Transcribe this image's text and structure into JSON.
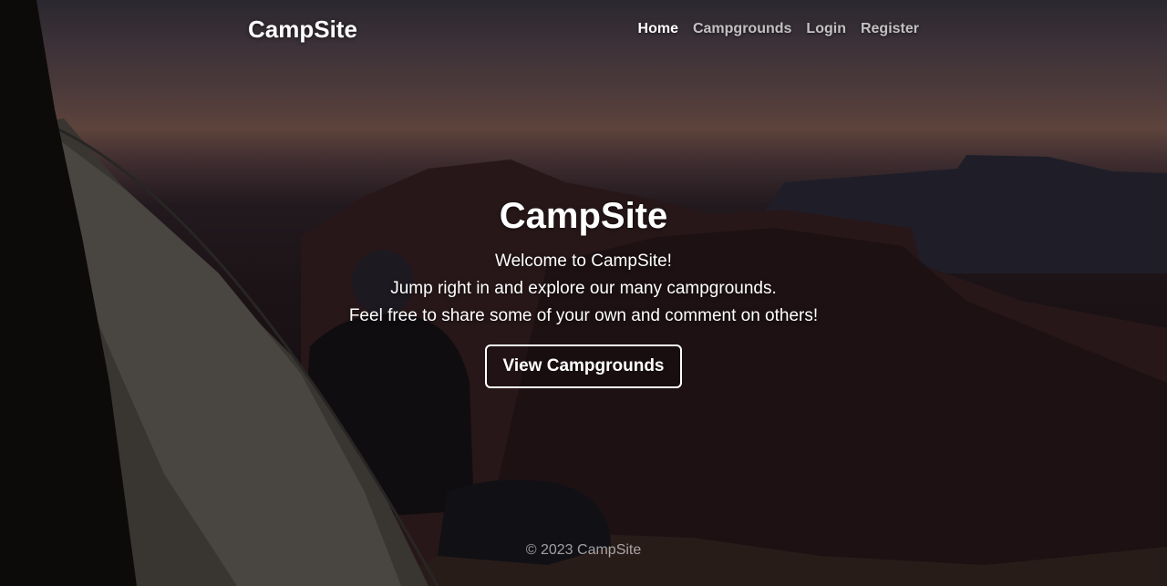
{
  "nav": {
    "brand": "CampSite",
    "links": [
      {
        "label": "Home",
        "active": true
      },
      {
        "label": "Campgrounds",
        "active": false
      },
      {
        "label": "Login",
        "active": false
      },
      {
        "label": "Register",
        "active": false
      }
    ]
  },
  "hero": {
    "title": "CampSite",
    "lines": [
      "Welcome to CampSite!",
      "Jump right in and explore our many campgrounds.",
      "Feel free to share some of your own and comment on others!"
    ],
    "button_label": "View Campgrounds"
  },
  "footer": {
    "text": "© 2023 CampSite"
  },
  "colors": {
    "text": "#ffffff",
    "muted_link": "rgba(255,255,255,0.72)",
    "overlay": "rgba(0,0,0,0.32)"
  }
}
